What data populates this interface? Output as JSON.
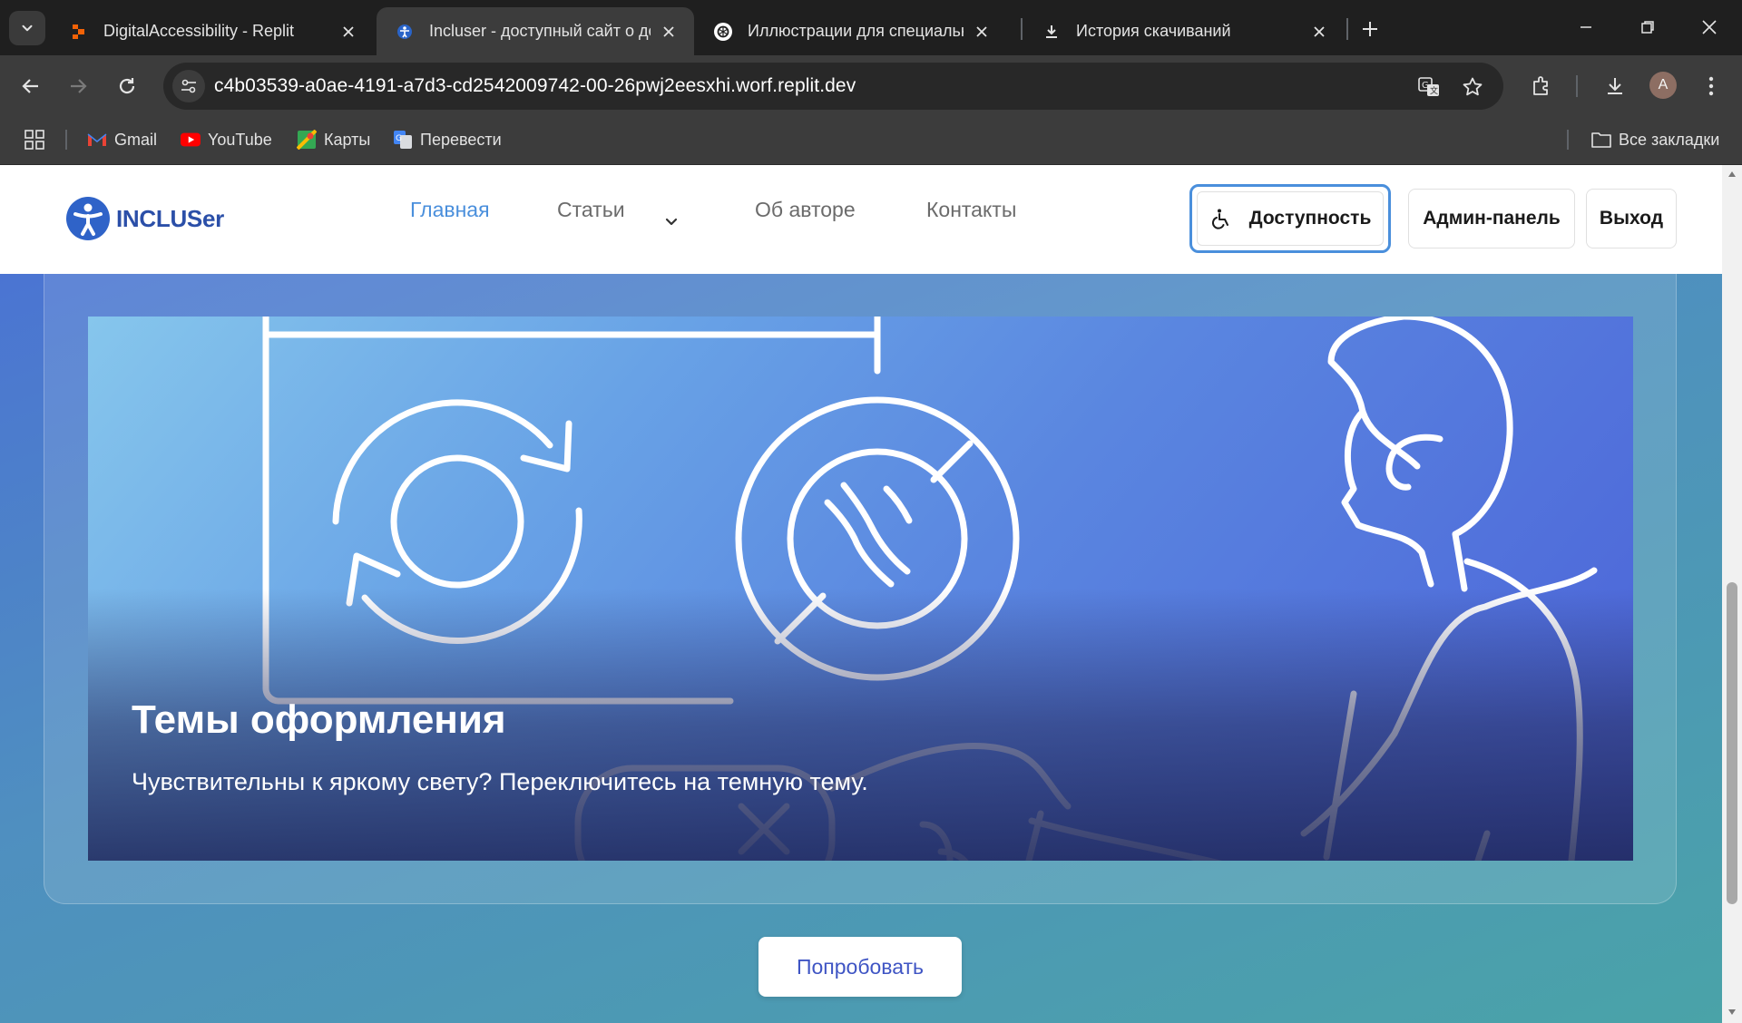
{
  "browser": {
    "tabs": [
      {
        "title": "DigitalAccessibility - Replit",
        "icon": "replit-icon",
        "active": false
      },
      {
        "title": "Incluser - доступный сайт о до",
        "icon": "site-favicon",
        "active": true
      },
      {
        "title": "Иллюстрации для специальны",
        "icon": "chatgpt-icon",
        "active": false
      },
      {
        "title": "История скачиваний",
        "icon": "download-icon",
        "active": false
      }
    ],
    "url": "c4b03539-a0ae-4191-a7d3-cd2542009742-00-26pwj2eesxhi.worf.replit.dev",
    "profile_initial": "A",
    "bookmarks": [
      {
        "label": "Gmail",
        "icon": "gmail-icon"
      },
      {
        "label": "YouTube",
        "icon": "youtube-icon"
      },
      {
        "label": "Карты",
        "icon": "maps-icon"
      },
      {
        "label": "Перевести",
        "icon": "translate-icon"
      }
    ],
    "all_bookmarks_label": "Все закладки"
  },
  "site": {
    "logo_text": "INCLUSer",
    "nav": {
      "home": "Главная",
      "articles": "Статьи",
      "about": "Об авторе",
      "contacts": "Контакты"
    },
    "buttons": {
      "accessibility": "Доступность",
      "admin": "Админ-панель",
      "logout": "Выход"
    },
    "accent_color": "#4a8fdc"
  },
  "hero": {
    "title": "Темы оформления",
    "subtitle": "Чувствительны к яркому свету? Переключитесь на темную тему.",
    "illustration": "theme-switch-illustration"
  },
  "cta": {
    "label": "Попробовать"
  }
}
